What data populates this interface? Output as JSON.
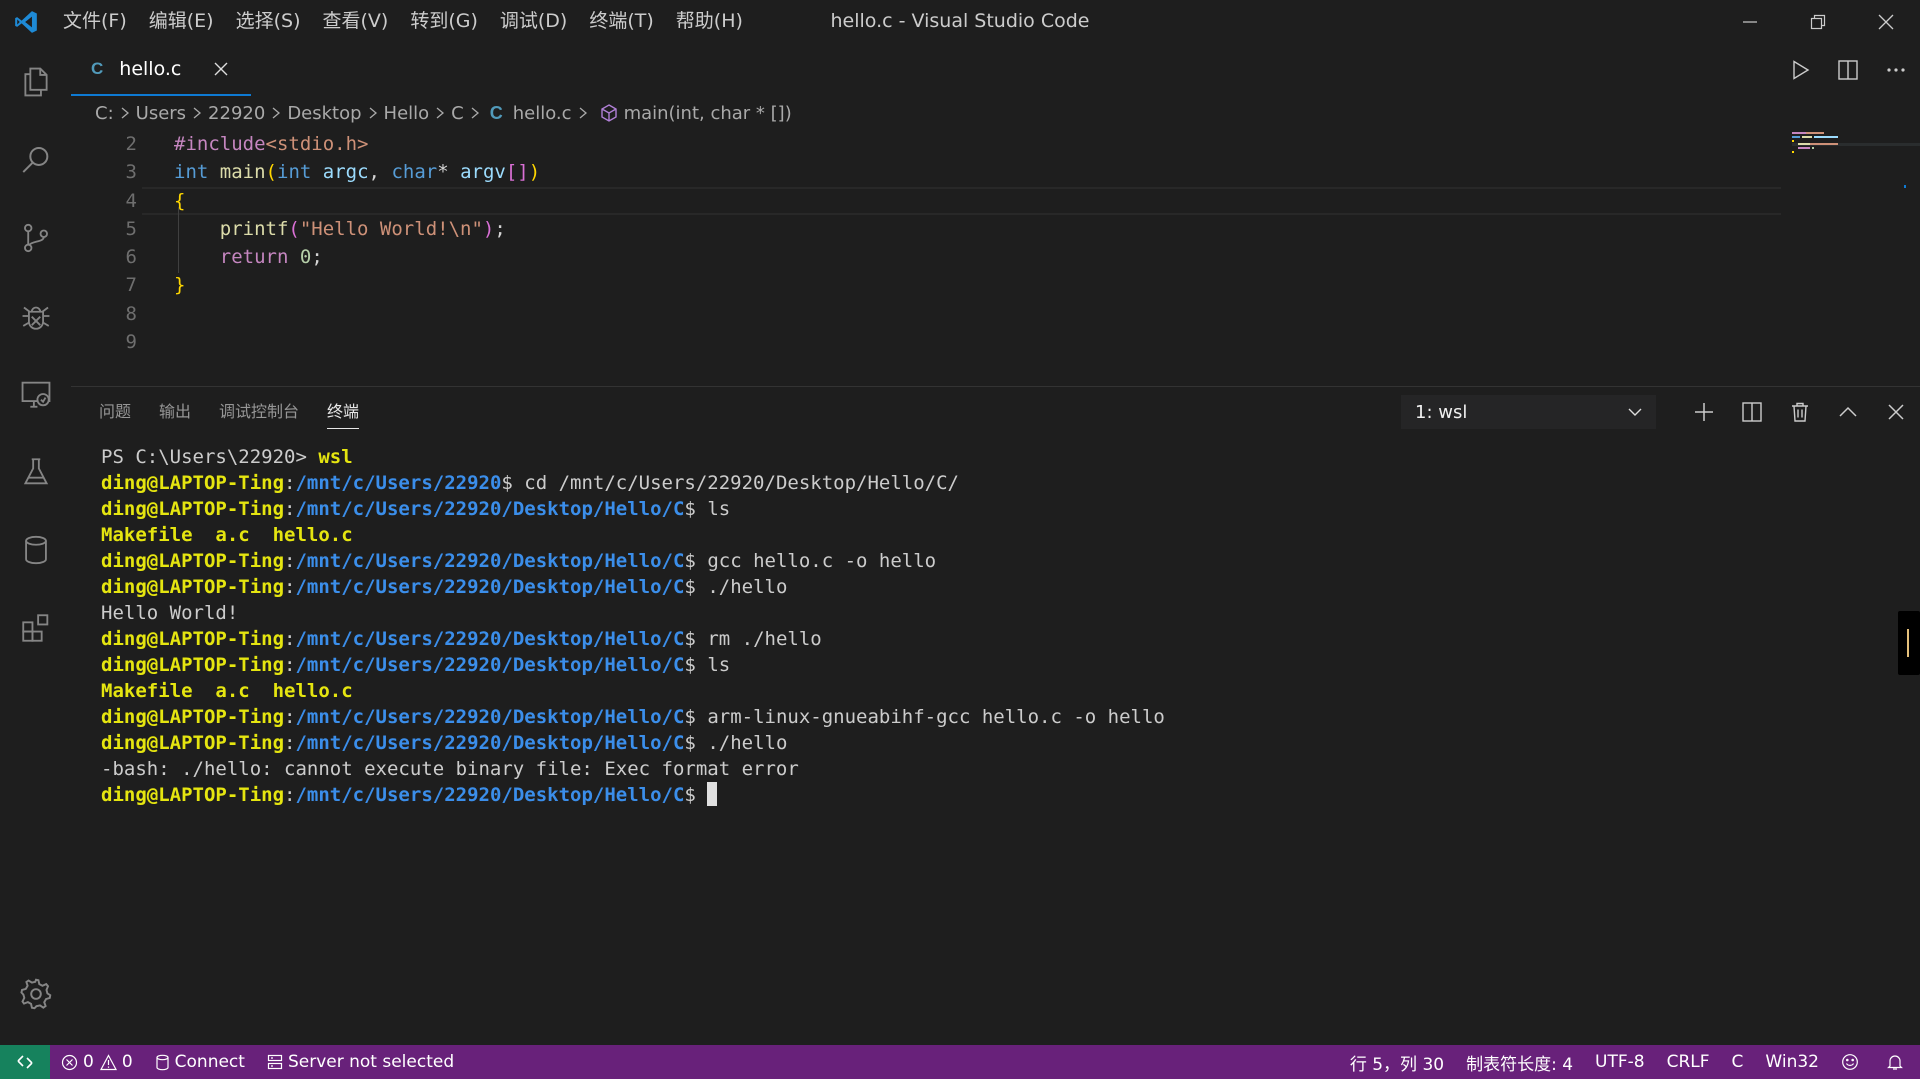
{
  "window": {
    "title": "hello.c - Visual Studio Code",
    "menu": [
      "文件(F)",
      "编辑(E)",
      "选择(S)",
      "查看(V)",
      "转到(G)",
      "调试(D)",
      "终端(T)",
      "帮助(H)"
    ]
  },
  "activity_bar": {
    "items": [
      "explorer-icon",
      "search-icon",
      "source-control-icon",
      "debug-icon",
      "remote-explorer-icon",
      "test-icon",
      "database-icon",
      "extensions-icon"
    ],
    "bottom": "settings-gear-icon"
  },
  "editor": {
    "tab": {
      "icon_text": "C",
      "label": "hello.c"
    },
    "breadcrumb": [
      "C:",
      "Users",
      "22920",
      "Desktop",
      "Hello",
      "C",
      "hello.c",
      "main(int, char * [])"
    ],
    "breadcrumb_file_icon": "C",
    "line_numbers": [
      "2",
      "3",
      "4",
      "5",
      "6",
      "7",
      "8",
      "9"
    ],
    "current_line": 5
  },
  "panel": {
    "tabs": [
      "问题",
      "输出",
      "调试控制台",
      "终端"
    ],
    "active_tab": "终端",
    "terminal_selector": "1: wsl",
    "terminal": {
      "user": "ding@LAPTOP-Ting",
      "lines": [
        {
          "type": "plain",
          "text": "PS C:\\Users\\22920> ",
          "cmd": "wsl"
        },
        {
          "type": "prompt",
          "path": "/mnt/c/Users/22920",
          "cmd": "cd /mnt/c/Users/22920/Desktop/Hello/C/"
        },
        {
          "type": "prompt",
          "path": "/mnt/c/Users/22920/Desktop/Hello/C",
          "cmd": "ls"
        },
        {
          "type": "output-yellow",
          "text": "Makefile  a.c  hello.c"
        },
        {
          "type": "prompt",
          "path": "/mnt/c/Users/22920/Desktop/Hello/C",
          "cmd": "gcc hello.c -o hello"
        },
        {
          "type": "prompt",
          "path": "/mnt/c/Users/22920/Desktop/Hello/C",
          "cmd": "./hello"
        },
        {
          "type": "output",
          "text": "Hello World!"
        },
        {
          "type": "prompt",
          "path": "/mnt/c/Users/22920/Desktop/Hello/C",
          "cmd": "rm ./hello"
        },
        {
          "type": "prompt",
          "path": "/mnt/c/Users/22920/Desktop/Hello/C",
          "cmd": "ls"
        },
        {
          "type": "output-yellow",
          "text": "Makefile  a.c  hello.c"
        },
        {
          "type": "prompt",
          "path": "/mnt/c/Users/22920/Desktop/Hello/C",
          "cmd": "arm-linux-gnueabihf-gcc hello.c -o hello"
        },
        {
          "type": "prompt",
          "path": "/mnt/c/Users/22920/Desktop/Hello/C",
          "cmd": "./hello"
        },
        {
          "type": "output",
          "text": "-bash: ./hello: cannot execute binary file: Exec format error"
        },
        {
          "type": "prompt-cursor",
          "path": "/mnt/c/Users/22920/Desktop/Hello/C",
          "cmd": ""
        }
      ]
    }
  },
  "status_bar": {
    "errors": "0",
    "warnings": "0",
    "connect": "Connect",
    "server": "Server not selected",
    "position": "行 5，列 30",
    "tab_size": "制表符长度: 4",
    "encoding": "UTF-8",
    "eol": "CRLF",
    "language": "C",
    "platform": "Win32"
  },
  "colors": {
    "status_bar": "#68217a",
    "remote_button": "#16825d",
    "accent": "#0e7ad3",
    "terminal_user": "#e5e510",
    "terminal_path": "#3b8eea"
  }
}
